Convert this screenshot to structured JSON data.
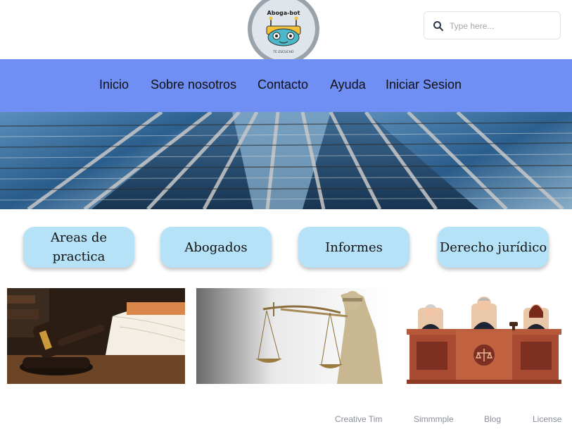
{
  "header": {
    "logo": {
      "title": "Aboga-bot",
      "tagline": "TE ESCUCHO"
    },
    "search": {
      "placeholder": "Type here...",
      "value": ""
    }
  },
  "nav": {
    "items": [
      {
        "label": "Inicio"
      },
      {
        "label": "Sobre nosotros"
      },
      {
        "label": "Contacto"
      },
      {
        "label": "Ayuda"
      },
      {
        "label": "Iniciar Sesion"
      }
    ],
    "background": "#6f8ff5"
  },
  "categories": [
    {
      "label": "Areas de practica"
    },
    {
      "label": "Abogados"
    },
    {
      "label": "Informes"
    },
    {
      "label": "Derecho jurídico"
    }
  ],
  "images": [
    {
      "icon": "gavel-and-book-photo"
    },
    {
      "icon": "lady-justice-scales-photo"
    },
    {
      "icon": "judges-panel-illustration"
    }
  ],
  "footer": {
    "links": [
      {
        "label": "Creative Tim"
      },
      {
        "label": "Simmmple"
      },
      {
        "label": "Blog"
      },
      {
        "label": "License"
      }
    ]
  },
  "colors": {
    "pill": "#b5e2f7",
    "nav": "#6f8ff5",
    "footer_text": "#8a8f98"
  }
}
